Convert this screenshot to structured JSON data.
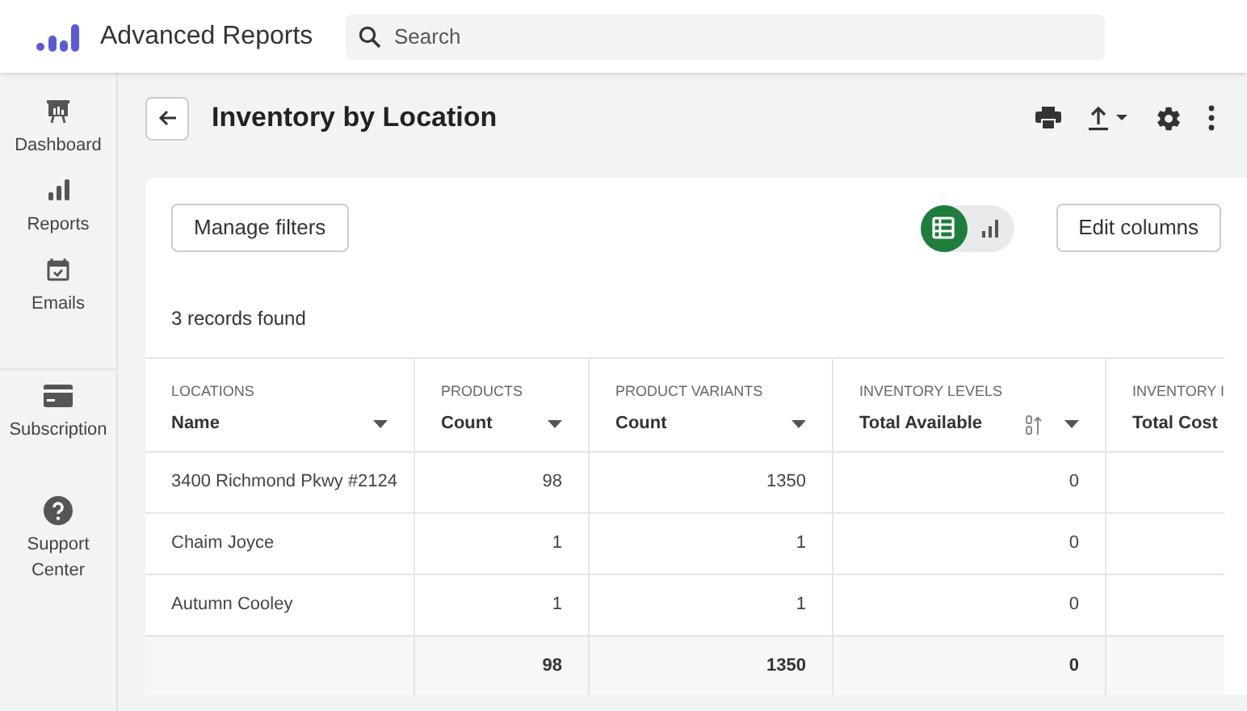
{
  "app": {
    "title": "Advanced Reports"
  },
  "search": {
    "placeholder": "Search"
  },
  "sidebar": {
    "items": [
      {
        "label": "Dashboard"
      },
      {
        "label": "Reports"
      },
      {
        "label": "Emails"
      },
      {
        "label": "Subscription"
      },
      {
        "label": "Support Center"
      }
    ]
  },
  "page": {
    "title": "Inventory by Location"
  },
  "toolbar": {
    "manage_filters": "Manage filters",
    "views": [
      {
        "kind": "table",
        "selected": true
      },
      {
        "kind": "chart",
        "selected": false
      }
    ],
    "edit_columns": "Edit columns",
    "records": "3 records found"
  },
  "table": {
    "columns": [
      {
        "group": "LOCATIONS",
        "label": "Name",
        "sorted": false
      },
      {
        "group": "PRODUCTS",
        "label": "Count",
        "sorted": false
      },
      {
        "group": "PRODUCT VARIANTS",
        "label": "Count",
        "sorted": false
      },
      {
        "group": "INVENTORY LEVELS",
        "label": "Total Available",
        "sorted": true
      },
      {
        "group": "INVENTORY I",
        "label": "Total Cost"
      }
    ],
    "rows": [
      [
        "3400 Richmond Pkwy #2124",
        "98",
        "1350",
        "0"
      ],
      [
        "Chaim Joyce",
        "1",
        "1",
        "0"
      ],
      [
        "Autumn Cooley",
        "1",
        "1",
        "0"
      ]
    ],
    "totals": [
      "98",
      "1350",
      "0"
    ]
  }
}
